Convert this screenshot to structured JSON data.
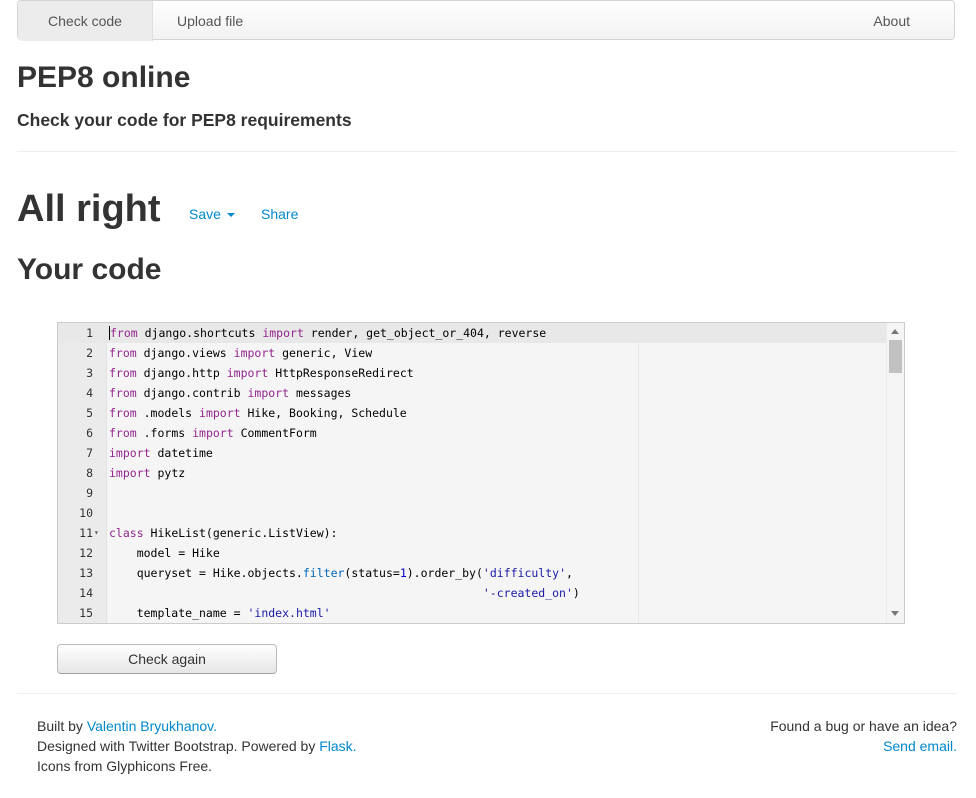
{
  "nav": {
    "check_code": "Check code",
    "upload_file": "Upload file",
    "about": "About"
  },
  "header": {
    "title": "PEP8 online",
    "subtitle": "Check your code for PEP8 requirements"
  },
  "result": {
    "status": "All right",
    "save_label": "Save",
    "share_label": "Share",
    "code_heading": "Your code"
  },
  "editor": {
    "lines": [
      {
        "n": "1",
        "code": "from django.shortcuts import render, get_object_or_404, reverse"
      },
      {
        "n": "2",
        "code": "from django.views import generic, View"
      },
      {
        "n": "3",
        "code": "from django.http import HttpResponseRedirect"
      },
      {
        "n": "4",
        "code": "from django.contrib import messages"
      },
      {
        "n": "5",
        "code": "from .models import Hike, Booking, Schedule"
      },
      {
        "n": "6",
        "code": "from .forms import CommentForm"
      },
      {
        "n": "7",
        "code": "import datetime"
      },
      {
        "n": "8",
        "code": "import pytz"
      },
      {
        "n": "9",
        "code": ""
      },
      {
        "n": "10",
        "code": ""
      },
      {
        "n": "11",
        "code": "class HikeList(generic.ListView):"
      },
      {
        "n": "12",
        "code": "    model = Hike"
      },
      {
        "n": "13",
        "code": "    queryset = Hike.objects.filter(status=1).order_by('difficulty',"
      },
      {
        "n": "14",
        "code": "                                                      '-created_on')"
      },
      {
        "n": "15",
        "code": "    template_name = 'index.html'"
      }
    ]
  },
  "check_again_label": "Check again",
  "footer": {
    "built_by_prefix": "Built by ",
    "author": "Valentin Bryukhanov.",
    "designed_prefix": "Designed with Twitter Bootstrap. Powered by ",
    "flask": "Flask.",
    "icons": "Icons from Glyphicons Free.",
    "bug_text": "Found a bug or have an idea?",
    "send_email": "Send email."
  },
  "colors": {
    "link": "#0088cc",
    "keyword": "#93258e",
    "function": "#0066bb",
    "string": "#1a1aa6"
  }
}
